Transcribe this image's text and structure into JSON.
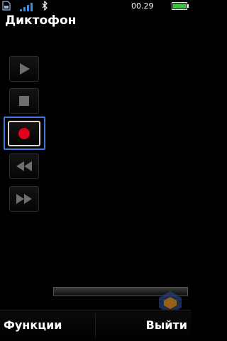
{
  "status_bar": {
    "time": "00.29",
    "signal_bars": 4,
    "battery_level": 1.0,
    "icons": [
      "sim-icon",
      "signal-icon",
      "bluetooth-icon",
      "battery-icon"
    ]
  },
  "app": {
    "title": "Диктофон"
  },
  "controls": [
    {
      "name": "play-button",
      "icon": "play-icon"
    },
    {
      "name": "stop-button",
      "icon": "stop-icon"
    },
    {
      "name": "record-button",
      "icon": "record-icon",
      "selected": true
    },
    {
      "name": "rewind-button",
      "icon": "rewind-icon"
    },
    {
      "name": "fast-forward-button",
      "icon": "fast-forward-icon"
    }
  ],
  "recording": {
    "progress": 0
  },
  "softkeys": {
    "left": "Функции",
    "right": "Выйти"
  },
  "colors": {
    "background": "#000000",
    "selection": "#3f7ae0",
    "record": "#e0001a",
    "signal": "#3a8de0",
    "battery": "#35c43a"
  }
}
